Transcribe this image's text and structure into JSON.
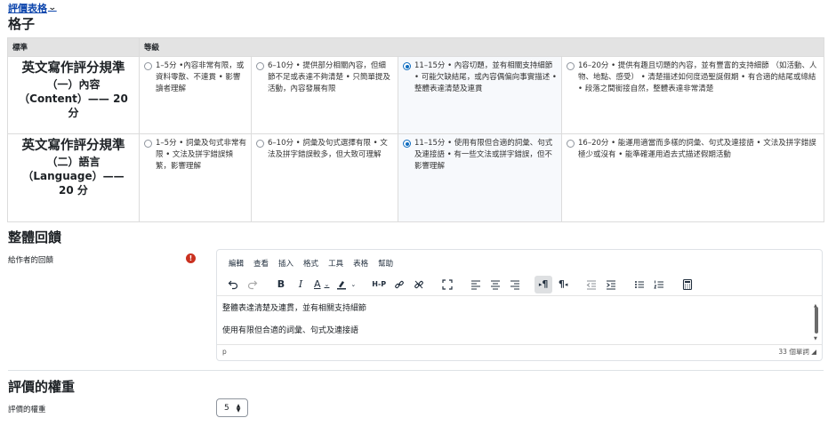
{
  "top_link": {
    "label": "評價表格",
    "chevron": "chevron-down-icon"
  },
  "section_rubric": {
    "title": "格子"
  },
  "rubric": {
    "headers": [
      "標準",
      "等級"
    ],
    "criteria": [
      {
        "title": "英文寫作評分規準",
        "subtitle_1": "（一）內容",
        "subtitle_2": "（Content）—— 20",
        "subtitle_3": "分",
        "levels": [
          {
            "text": "1–5分 •內容非常有限，或資料零散、不連貫 • 影響讀者理解",
            "selected": false
          },
          {
            "text": "6–10分 • 提供部分相關內容，但細節不足或表達不夠清楚 • 只簡單提及活動，內容發展有限",
            "selected": false
          },
          {
            "text": "11–15分 • 內容切題，並有相關支持細節 • 可能欠缺結尾，或內容偶偏向事實描述 • 整體表達清楚及連貫",
            "selected": true
          },
          {
            "text": "16–20分 • 提供有趣且切題的內容，並有豐富的支持細節 （如活動、人物、地點、感受） • 清楚描述如何度過聖誕假期 • 有合適的結尾或總結 • 段落之間銜接自然，整體表達非常清楚",
            "selected": false
          }
        ]
      },
      {
        "title": "英文寫作評分規準",
        "subtitle_1": "（二）語言",
        "subtitle_2": "（Language）——",
        "subtitle_3": "20 分",
        "levels": [
          {
            "text": "1–5分 • 詞彙及句式非常有限 • 文法及拼字錯誤頻繁，影響理解",
            "selected": false
          },
          {
            "text": "6–10分 • 詞彙及句式選擇有限 • 文法及拼字錯誤較多，但大致可理解",
            "selected": false
          },
          {
            "text": "11–15分 • 使用有限但合適的詞彙、句式及連接語 • 有一些文法或拼字錯誤，但不影響理解",
            "selected": true
          },
          {
            "text": "16–20分 • 能運用適當而多樣的詞彙、句式及連接語 • 文法及拼字錯誤極少或沒有 • 能準確運用過去式描述假期活動",
            "selected": false
          }
        ]
      }
    ]
  },
  "section_feedback": {
    "title": "整體回饋"
  },
  "feedback": {
    "label": "給作者的回饋",
    "required_icon": "exclamation-circle-icon",
    "required_mark": "!",
    "menu": [
      "編輯",
      "查看",
      "插入",
      "格式",
      "工具",
      "表格",
      "幫助"
    ],
    "toolbar": {
      "hp_label": "H-P",
      "bold": "B",
      "italic": "I",
      "font_color": "A",
      "ltr": "¶",
      "rtl": "¶"
    },
    "content": [
      "整體表達清楚及連貫，並有相關支持細節",
      "使用有限但合適的詞彙、句式及連接語"
    ],
    "status_path": "p",
    "word_count": "33 個單詞"
  },
  "section_weight": {
    "title": "評價的權重"
  },
  "weight": {
    "label": "評價的權重",
    "value": "5"
  }
}
